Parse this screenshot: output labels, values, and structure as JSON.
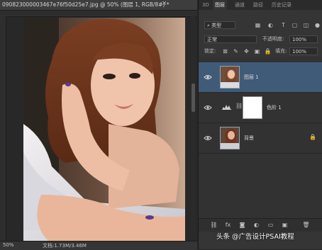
{
  "document": {
    "tab_title": "0908230000034​67e76f50d25e7.jpg @ 50% (图层 1, RGB/8#) *",
    "close_glyph": "×",
    "zoom": "50%",
    "doc_info": "文档:1.73M/3.46M"
  },
  "panel_tabs": [
    "3D",
    "图层",
    "通道",
    "路径",
    "历史记录"
  ],
  "active_tab_index": 1,
  "layers_panel": {
    "filter_label": "类型",
    "blend_mode": "正常",
    "opacity_label": "不透明度:",
    "opacity_value": "100%",
    "lock_label": "锁定:",
    "fill_label": "填充:",
    "fill_value": "100%",
    "layers": [
      {
        "name": "图层 1",
        "visible": true,
        "selected": true,
        "kind": "pixel"
      },
      {
        "name": "色阶 1",
        "visible": true,
        "selected": false,
        "kind": "adjustment"
      },
      {
        "name": "背景",
        "visible": true,
        "selected": false,
        "kind": "background",
        "locked": true
      }
    ]
  },
  "bottom_icons": [
    "link-icon",
    "fx-icon",
    "mask-icon",
    "adjustment-icon",
    "group-icon",
    "new-layer-icon",
    "trash-icon"
  ],
  "bottom_icon_glyphs": [
    "⛓",
    "fx",
    "◙",
    "◐",
    "▭",
    "▣",
    "🗑"
  ],
  "watermark": "头条 @广告设计PSAI教程",
  "colors": {
    "selected_layer": "#3f5b78",
    "panel_bg": "#353535",
    "workspace_bg": "#282828"
  }
}
